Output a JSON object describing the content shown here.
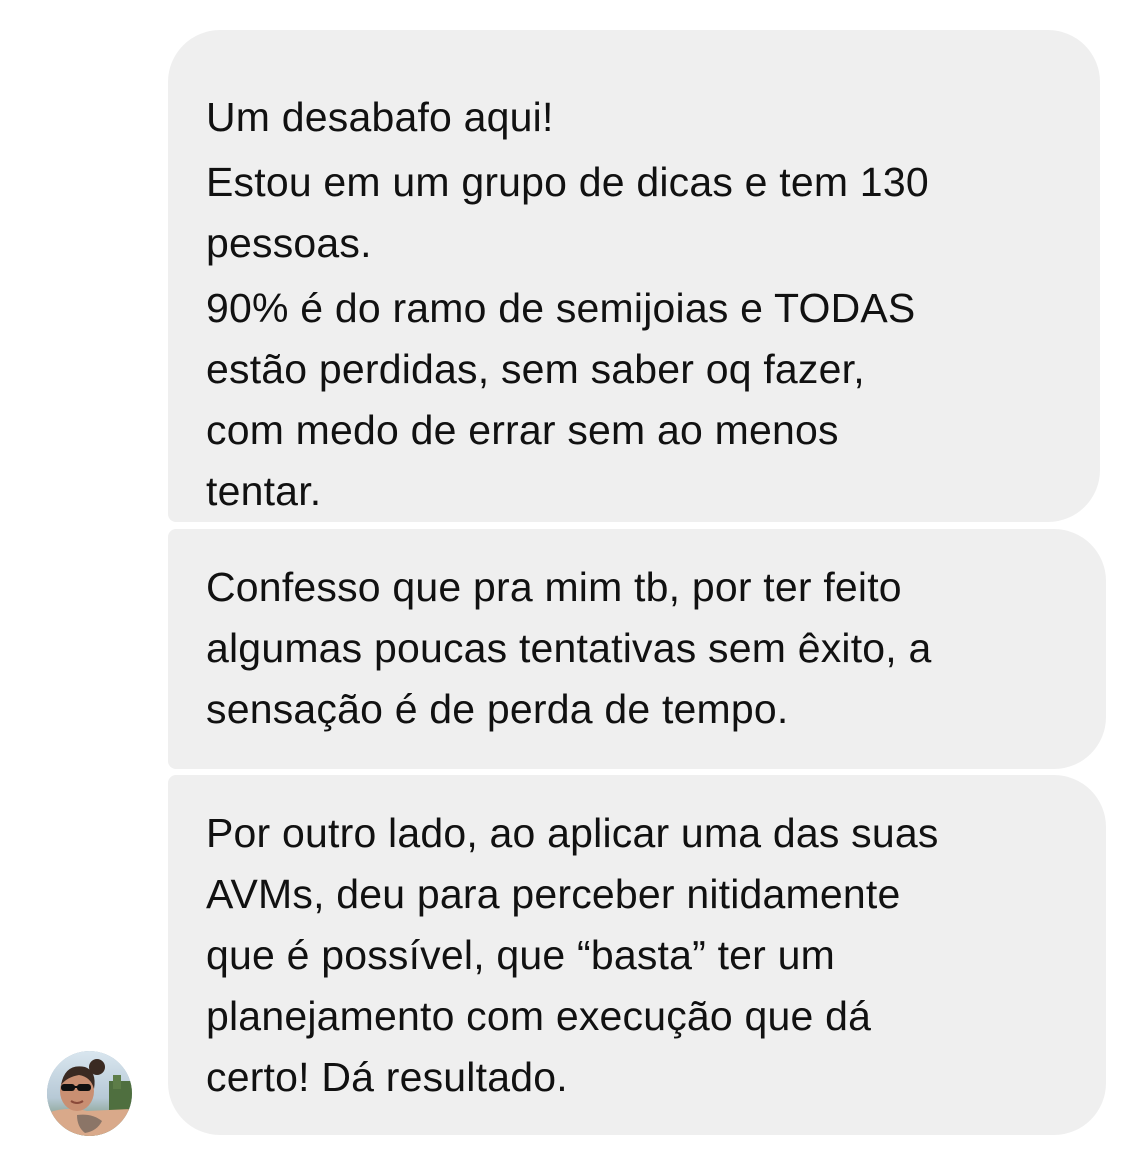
{
  "messages": [
    {
      "lines": [
        "Um desabafo aqui!",
        "Estou em um grupo de dicas e tem 130",
        "pessoas.",
        "90% é do ramo de semijoias e TODAS",
        "estão perdidas, sem saber oq fazer,",
        "com medo de errar sem ao menos",
        "tentar."
      ]
    },
    {
      "lines": [
        "Confesso que pra mim tb, por ter feito",
        "algumas poucas tentativas sem êxito, a",
        "sensação é de perda de tempo."
      ]
    },
    {
      "lines": [
        "Por outro lado, ao aplicar uma das suas",
        "AVMs, deu para perceber nitidamente",
        "que é possível, que “basta” ter um",
        "planejamento com execução que dá",
        "certo! Dá resultado."
      ]
    }
  ],
  "sender": {
    "avatar_icon": "profile-photo-avatar"
  },
  "colors": {
    "bubble_background": "#efefef",
    "text": "#111111",
    "page_background": "#ffffff"
  }
}
